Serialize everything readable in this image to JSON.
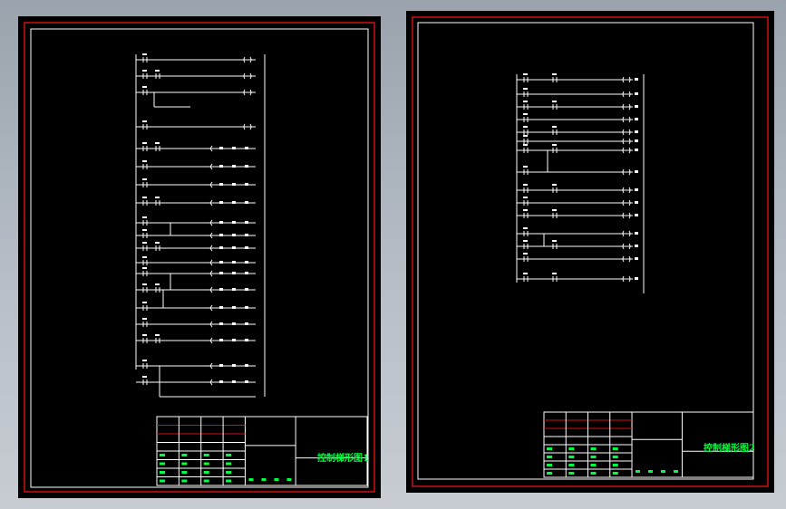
{
  "sheets": [
    {
      "id": "sheet1",
      "title": "控制梯形图1"
    },
    {
      "id": "sheet2",
      "title": "控制梯形图2"
    }
  ],
  "colors": {
    "frame_outer": "#d01010",
    "frame_inner": "#ffffff",
    "ladder": "#ffffff",
    "label": "#00ff40",
    "background": "#000000"
  }
}
